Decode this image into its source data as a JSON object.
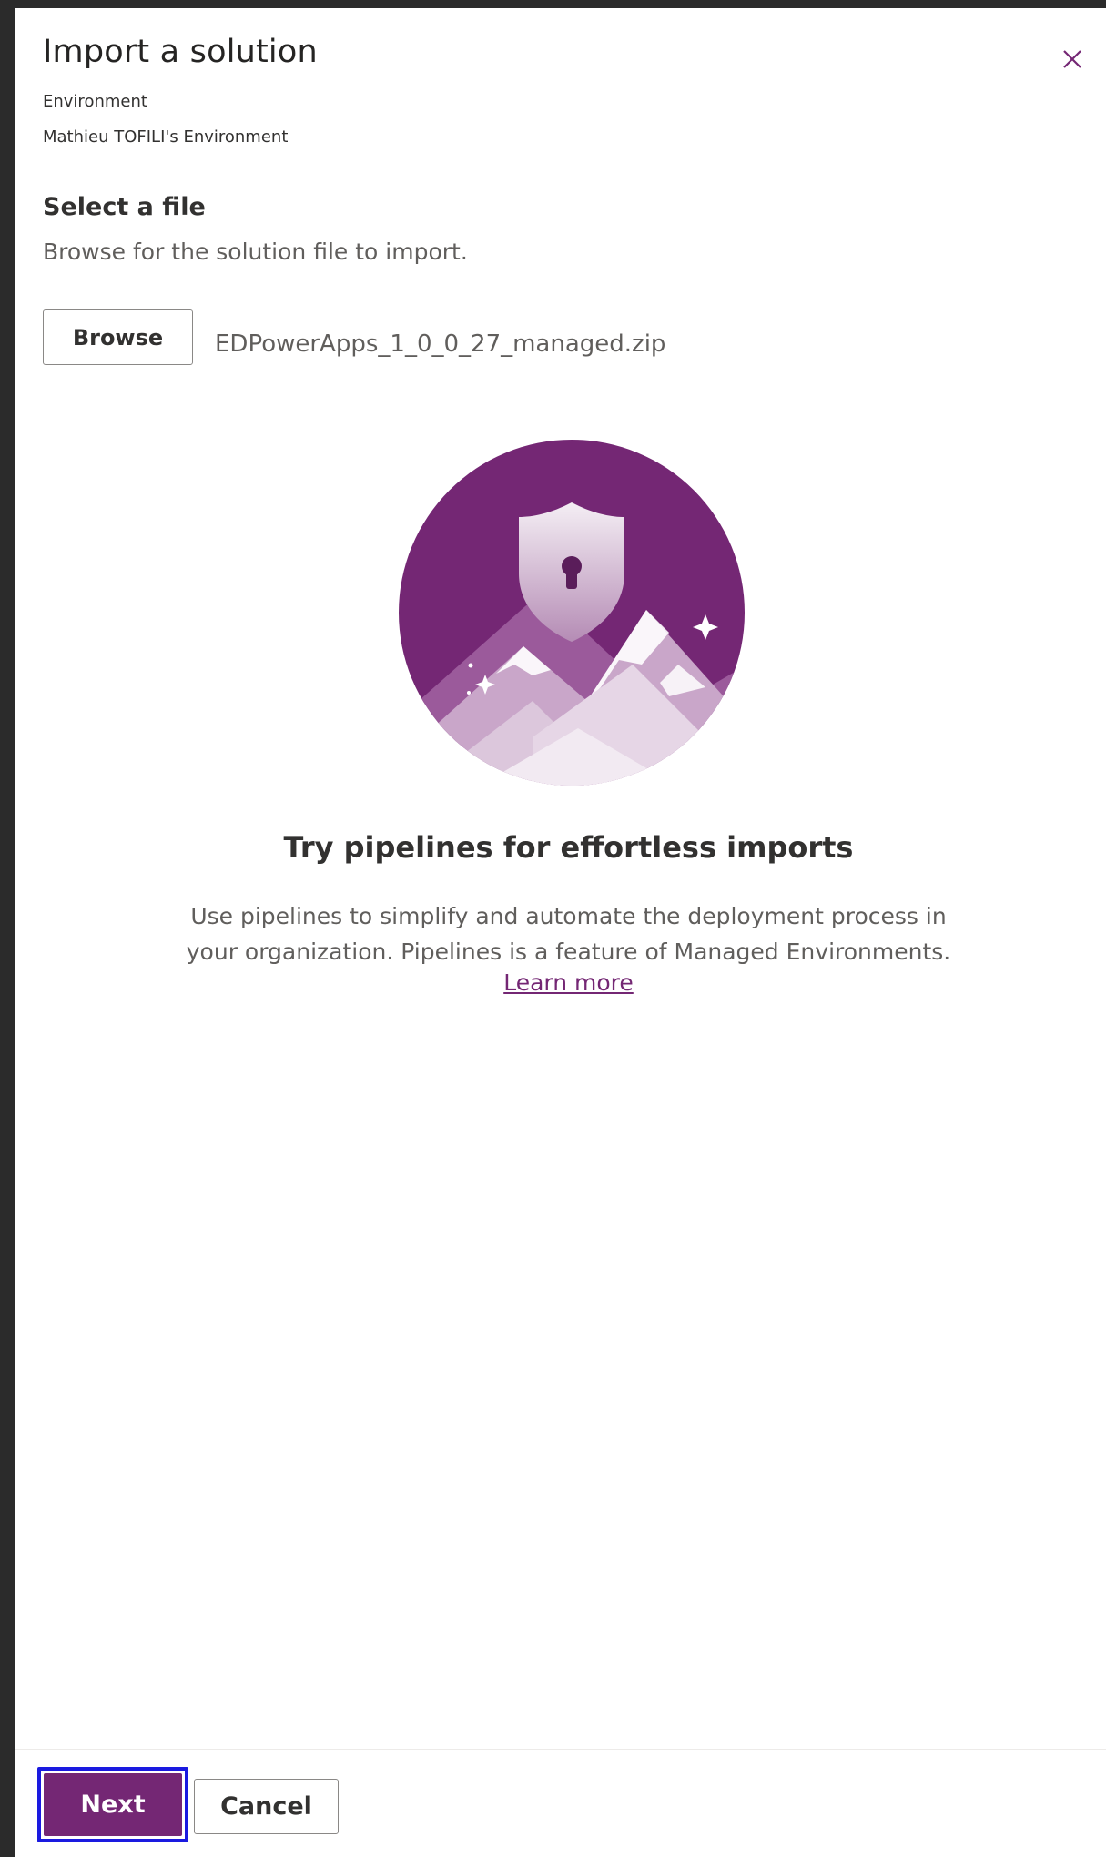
{
  "dialog": {
    "title": "Import a solution",
    "environment_label": "Environment",
    "environment_value": "Mathieu TOFILI's Environment",
    "close_icon": "close-icon"
  },
  "file_section": {
    "title": "Select a file",
    "description": "Browse for the solution file to import.",
    "browse_label": "Browse",
    "selected_file": "EDPowerApps_1_0_0_27_managed.zip"
  },
  "promo": {
    "illustration": "shield-mountain-illustration",
    "title": "Try pipelines for effortless imports",
    "line1": "Use pipelines to simplify and automate the deployment process in",
    "line2": "your organization. Pipelines is a feature of Managed Environments.",
    "link_label": "Learn more"
  },
  "footer": {
    "next_label": "Next",
    "cancel_label": "Cancel"
  },
  "colors": {
    "accent": "#742774",
    "highlight": "#1a1ae0",
    "backdrop": "#2b2b2b"
  }
}
